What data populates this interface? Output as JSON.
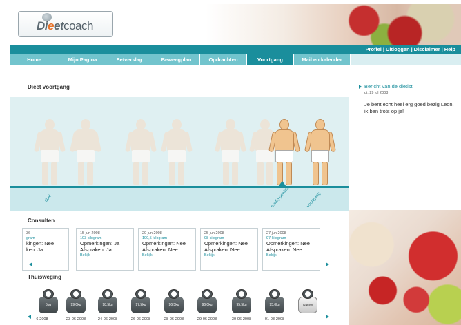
{
  "brand": {
    "logo_text_pre": "Di",
    "logo_text_e": "e",
    "logo_text_mid": "et",
    "logo_text_post": "coach"
  },
  "top_links": [
    "Profiel",
    "Uitloggen",
    "Disclaimer",
    "Help"
  ],
  "nav": {
    "tabs": [
      {
        "label": "Home",
        "active": false
      },
      {
        "label": "Mijn Pagina",
        "active": false
      },
      {
        "label": "Eetverslag",
        "active": false
      },
      {
        "label": "Beweegplan",
        "active": false
      },
      {
        "label": "Opdrachten",
        "active": false
      },
      {
        "label": "Voortgang",
        "active": true
      },
      {
        "label": "Mail en kalender",
        "active": false
      }
    ]
  },
  "progress": {
    "title": "Dieet voortgang",
    "timeline_labels": [
      "doel",
      "huidig gewicht",
      "voortgang"
    ]
  },
  "consulten": {
    "title": "Consulten",
    "cards": [
      {
        "date": "36",
        "weight": "gram",
        "opmerkingen": "kingen: Nee",
        "afspraken": "ken: Ja",
        "link": ""
      },
      {
        "date": "15 jun 2008",
        "weight": "103 kilogram",
        "opmerkingen": "Opmerkingen: Ja",
        "afspraken": "Afspraken: Ja",
        "link": "Bekijk"
      },
      {
        "date": "20 jun 2008",
        "weight": "100,5 kilogram",
        "opmerkingen": "Opmerkingen: Nee",
        "afspraken": "Afspraken: Nee",
        "link": "Bekijk"
      },
      {
        "date": "25 jun 2008",
        "weight": "98 kilogram",
        "opmerkingen": "Opmerkingen: Nee",
        "afspraken": "Afspraken: Nee",
        "link": "Bekijk"
      },
      {
        "date": "27 jun 2008",
        "weight": "97 kilogram",
        "opmerkingen": "Opmerkingen: Nee",
        "afspraken": "Afspraken: Nee",
        "link": "Bekijk"
      }
    ]
  },
  "thuisweging": {
    "title": "Thuisweging",
    "scales": [
      {
        "value": "5kg",
        "date": "6-2008"
      },
      {
        "value": "99,0kg",
        "date": "23-06-2008"
      },
      {
        "value": "98,5kg",
        "date": "24-06-2008"
      },
      {
        "value": "97,5kg",
        "date": "26-06-2008"
      },
      {
        "value": "96,5kg",
        "date": "28-06-2008"
      },
      {
        "value": "96,0kg",
        "date": "29-06-2008"
      },
      {
        "value": "95,5kg",
        "date": "30-06-2008"
      },
      {
        "value": "95,0kg",
        "date": "01-08-2008"
      },
      {
        "value": "Nieuw",
        "date": ""
      }
    ]
  },
  "dietist": {
    "title": "Bericht van de dietist",
    "date": "di, 29 jul 2008",
    "message": "Je bent echt heel erg goed bezig Leon, ik ben trots op je!"
  },
  "colors": {
    "accent": "#1a8e9c",
    "tab": "#72c4cd",
    "band": "#dff0f2"
  }
}
